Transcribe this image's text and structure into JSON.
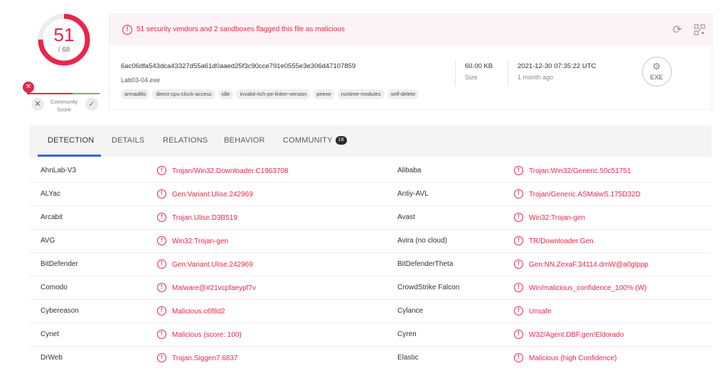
{
  "score": {
    "detections": "51",
    "total": "/ 68"
  },
  "community": {
    "label": "Community Score",
    "vote_down": "✕",
    "vote_up": "✓",
    "pin_icon": "✕"
  },
  "alert": {
    "icon": "!",
    "text": "51 security vendors and 2 sandboxes flagged this file as malicious"
  },
  "file": {
    "hash": "6ac06dfa543dca43327d55a61d0aaed25f3c90cce791e0555e3e306d47107859",
    "name": "Lab03-04.exe",
    "tags": [
      "armadillo",
      "direct-cpu-clock-access",
      "idle",
      "invalid-rich-pe-linker-version",
      "peexe",
      "runtime-modules",
      "self-delete"
    ],
    "size_value": "60.00 KB",
    "size_label": "Size",
    "date_value": "2021-12-30 07:35:22 UTC",
    "date_label": "1 month ago",
    "type_icon": "EXE"
  },
  "tabs": [
    {
      "label": "DETECTION"
    },
    {
      "label": "DETAILS"
    },
    {
      "label": "RELATIONS"
    },
    {
      "label": "BEHAVIOR"
    },
    {
      "label": "COMMUNITY",
      "badge": "18"
    }
  ],
  "results": [
    {
      "engine1": "AhnLab-V3",
      "result1": "Trojan/Win32.Downloader.C1963708",
      "engine2": "Alibaba",
      "result2": "Trojan:Win32/Generic.50c51751"
    },
    {
      "engine1": "ALYac",
      "result1": "Gen:Variant.Ulise.242969",
      "engine2": "Antiy-AVL",
      "result2": "Trojan/Generic.ASMalwS.175D32D"
    },
    {
      "engine1": "Arcabit",
      "result1": "Trojan.Ulise.D3B519",
      "engine2": "Avast",
      "result2": "Win32:Trojan-gen"
    },
    {
      "engine1": "AVG",
      "result1": "Win32:Trojan-gen",
      "engine2": "Avira (no cloud)",
      "result2": "TR/Downloader.Gen"
    },
    {
      "engine1": "BitDefender",
      "result1": "Gen:Variant.Ulise.242969",
      "engine2": "BitDefenderTheta",
      "result2": "Gen:NN.ZexaF.34114.dmW@a0glppp"
    },
    {
      "engine1": "Comodo",
      "result1": "Malware@#21vcpfaeypf7v",
      "engine2": "CrowdStrike Falcon",
      "result2": "Win/malicious_confidence_100% (W)"
    },
    {
      "engine1": "Cybereason",
      "result1": "Malicious.c6f8d2",
      "engine2": "Cylance",
      "result2": "Unsafe"
    },
    {
      "engine1": "Cynet",
      "result1": "Malicious (score: 100)",
      "engine2": "Cyren",
      "result2": "W32/Agent.DBF.gen!Eldorado"
    },
    {
      "engine1": "DrWeb",
      "result1": "Trojan.Siggen7.6837",
      "engine2": "Elastic",
      "result2": "Malicious (high Confidence)"
    }
  ],
  "colors": {
    "malicious": "#e8264a",
    "harmless": "#6db37b",
    "tab_accent": "#3a5ee0"
  },
  "icons": {
    "reload": "reload-icon",
    "qr": "qr-code-icon",
    "alert": "alert-circle-icon",
    "file_type": "exe-file-icon"
  }
}
